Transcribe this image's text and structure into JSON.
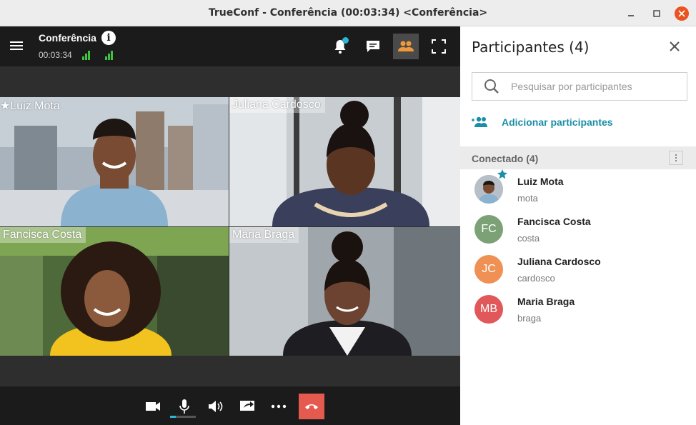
{
  "window": {
    "title": "TrueConf - Conferência (00:03:34) <Conferência>",
    "minimize": "–",
    "maximize": "□",
    "close": "✕"
  },
  "conference": {
    "name": "Conferência",
    "elapsed": "00:03:34"
  },
  "colors": {
    "accent": "#1a8ea8",
    "end_call": "#e55a4f",
    "topbar": "#1b1b1b",
    "signal": "#3ec33e"
  },
  "toolbar_icons": [
    "notifications-icon",
    "chat-icon",
    "participants-icon",
    "fullscreen-icon"
  ],
  "tiles": [
    {
      "name": "★Luiz Mota"
    },
    {
      "name": "Juliana Cardosco"
    },
    {
      "name": "Fancisca Costa"
    },
    {
      "name": "Maria Braga"
    }
  ],
  "call_controls": [
    "camera-icon",
    "microphone-icon",
    "speaker-icon",
    "share-screen-icon",
    "more-icon",
    "end-call-icon"
  ],
  "panel": {
    "title": "Participantes (4)",
    "search_placeholder": "Pesquisar por participantes",
    "add_label": "Adicionar participantes",
    "section_label": "Conectado (4)",
    "participants": [
      {
        "name": "Luiz Mota",
        "login": "mota",
        "initials": "",
        "color": "#c9b9a6",
        "owner": true
      },
      {
        "name": "Fancisca Costa",
        "login": "costa",
        "initials": "FC",
        "color": "#7da176"
      },
      {
        "name": "Juliana Cardosco",
        "login": "cardosco",
        "initials": "JC",
        "color": "#ef9154"
      },
      {
        "name": "Maria Braga",
        "login": "braga",
        "initials": "MB",
        "color": "#e0585a"
      }
    ]
  }
}
